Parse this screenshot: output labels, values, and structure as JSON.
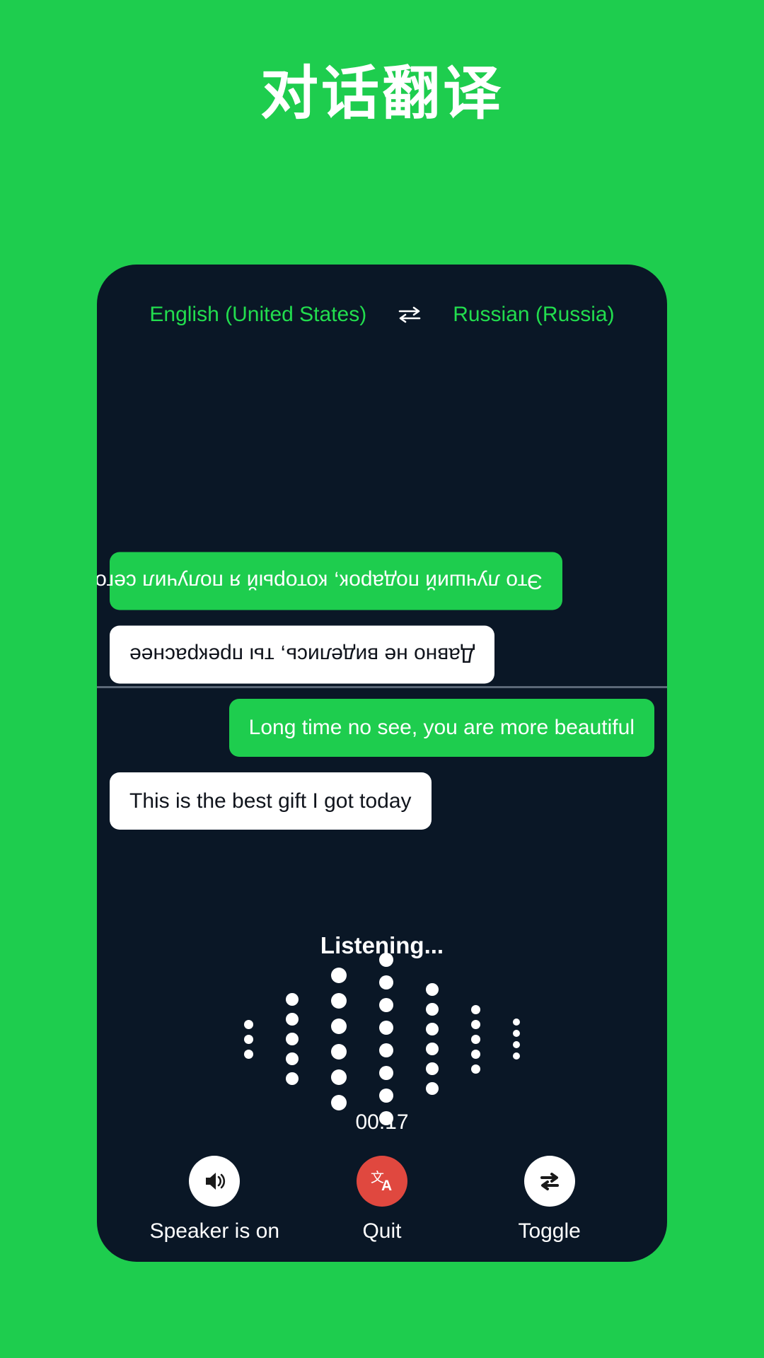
{
  "page": {
    "title": "对话翻译",
    "background_color": "#1ecd4e",
    "card_color": "#0a1726"
  },
  "language_bar": {
    "source": "English (United States)",
    "swap_icon": "swap-horizontal-icon",
    "swap_glyph": "⇌",
    "target": "Russian (Russia)",
    "accent_color": "#22dd4e"
  },
  "conversation": {
    "top_pane_rotated": true,
    "top_messages": [
      {
        "text": "Это лучший подарок, который я получил сегодня",
        "style": "green",
        "align": "right"
      },
      {
        "text": "Давно не виделись, ты прекраснее",
        "style": "white",
        "align": "right"
      }
    ],
    "bottom_messages": [
      {
        "text": "Long time no see, you are more beautiful",
        "style": "green",
        "align": "right"
      },
      {
        "text": "This is the best gift I got today",
        "style": "white",
        "align": "left"
      }
    ]
  },
  "status": {
    "listening_label": "Listening...",
    "timer": "00:17"
  },
  "waveform": {
    "type": "dot-bars",
    "columns": [
      {
        "dots": 3,
        "size": 13
      },
      {
        "dots": 5,
        "size": 18
      },
      {
        "dots": 6,
        "size": 22
      },
      {
        "dots": 8,
        "size": 20
      },
      {
        "dots": 6,
        "size": 18
      },
      {
        "dots": 5,
        "size": 13
      },
      {
        "dots": 4,
        "size": 10
      }
    ]
  },
  "controls": [
    {
      "label": "Speaker is on",
      "icon": "speaker-on-icon",
      "circle": "white",
      "color": "#ffffff"
    },
    {
      "label": "Quit",
      "icon": "translate-icon",
      "circle": "red",
      "color": "#e0483f"
    },
    {
      "label": "Toggle",
      "icon": "swap-arrows-icon",
      "circle": "white",
      "color": "#ffffff"
    }
  ]
}
